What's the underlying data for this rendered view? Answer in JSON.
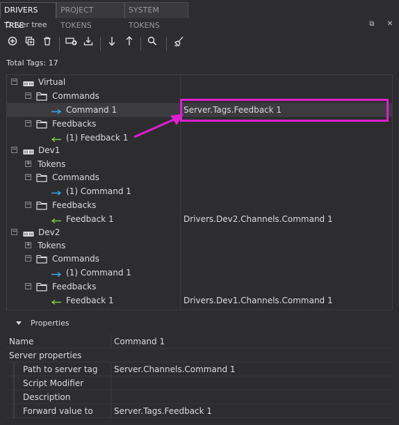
{
  "tabs": [
    {
      "label": "DRIVERS TREE",
      "active": true
    },
    {
      "label": "PROJECT TOKENS",
      "active": false
    },
    {
      "label": "SYSTEM TOKENS",
      "active": false
    }
  ],
  "panel": {
    "title": "Driver tree"
  },
  "toolbar": {
    "buttons": [
      "add-icon",
      "duplicate-icon",
      "delete-icon",
      "add-device-icon",
      "import-icon",
      "move-down-icon",
      "move-up-icon",
      "search-icon",
      "clear-icon"
    ]
  },
  "summary": {
    "total_tags": "Total Tags: 17"
  },
  "tree": {
    "nodes": [
      {
        "label": "Virtual",
        "value": ""
      },
      {
        "label": "Commands",
        "value": ""
      },
      {
        "label": "Command 1",
        "value": "Server.Tags.Feedback 1"
      },
      {
        "label": "Feedbacks",
        "value": ""
      },
      {
        "label": "(1) Feedback 1",
        "value": ""
      },
      {
        "label": "Dev1",
        "value": ""
      },
      {
        "label": "Tokens",
        "value": ""
      },
      {
        "label": "Commands",
        "value": ""
      },
      {
        "label": "(1) Command 1",
        "value": ""
      },
      {
        "label": "Feedbacks",
        "value": ""
      },
      {
        "label": "Feedback 1",
        "value": "Drivers.Dev2.Channels.Command 1"
      },
      {
        "label": "Dev2",
        "value": ""
      },
      {
        "label": "Tokens",
        "value": ""
      },
      {
        "label": "Commands",
        "value": ""
      },
      {
        "label": "(1) Command 1",
        "value": ""
      },
      {
        "label": "Feedbacks",
        "value": ""
      },
      {
        "label": "Feedback 1",
        "value": "Drivers.Dev1.Channels.Command 1"
      }
    ]
  },
  "properties": {
    "title": "Properties",
    "rows": [
      {
        "name": "Name",
        "value": "Command 1"
      },
      {
        "name": "Server properties",
        "value": ""
      },
      {
        "name": "Path to server tag",
        "value": "Server.Channels.Command 1"
      },
      {
        "name": "Script Modifier",
        "value": ""
      },
      {
        "name": "Description",
        "value": ""
      },
      {
        "name": "Forward value to",
        "value": "Server.Tags.Feedback 1"
      }
    ]
  },
  "colors": {
    "accent": "#e01ed0",
    "command_arrow": "#3aa7e8",
    "feedback_arrow": "#7cc84a"
  }
}
